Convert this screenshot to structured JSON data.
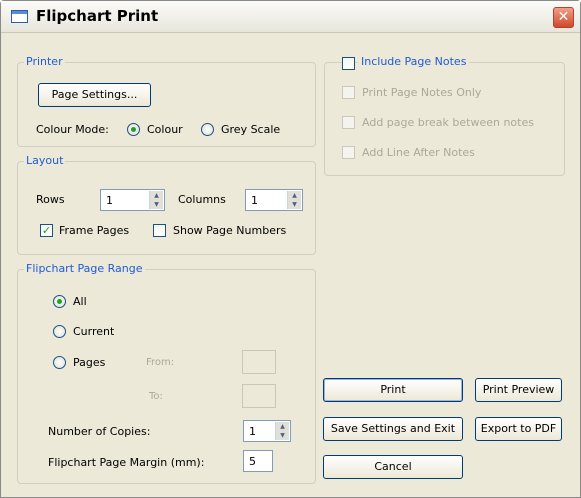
{
  "window": {
    "title": "Flipchart Print",
    "close_symbol": "✕"
  },
  "printer": {
    "group_title": "Printer",
    "page_settings_label": "Page Settings...",
    "colour_mode_label": "Colour Mode:",
    "colour_option": "Colour",
    "grey_option": "Grey Scale",
    "selected_mode": "Colour"
  },
  "layout": {
    "group_title": "Layout",
    "rows_label": "Rows",
    "rows_value": "1",
    "columns_label": "Columns",
    "columns_value": "1",
    "frame_pages_label": "Frame Pages",
    "frame_pages_checked": true,
    "show_page_numbers_label": "Show Page Numbers",
    "show_page_numbers_checked": false
  },
  "range": {
    "group_title": "Flipchart Page Range",
    "all_label": "All",
    "current_label": "Current",
    "pages_label": "Pages",
    "from_label": "From:",
    "to_label": "To:",
    "selected": "All",
    "copies_label": "Number of Copies:",
    "copies_value": "1",
    "margin_label": "Flipchart Page Margin (mm):",
    "margin_value": "5"
  },
  "notes": {
    "include_label": "Include Page Notes",
    "include_checked": false,
    "print_only_label": "Print Page Notes Only",
    "page_break_label": "Add page break between notes",
    "line_after_label": "Add Line After Notes"
  },
  "buttons": {
    "print": "Print",
    "print_preview": "Print Preview",
    "save_settings": "Save Settings and Exit",
    "export_pdf": "Export to PDF",
    "cancel": "Cancel"
  },
  "icons": {
    "spin_up": "▲",
    "spin_down": "▼",
    "check_mark": "✓"
  },
  "colors": {
    "group_title_blue": "#1f5bd6",
    "window_bg": "#ece9d8",
    "close_red": "#d2472a",
    "check_green": "#21a121"
  }
}
